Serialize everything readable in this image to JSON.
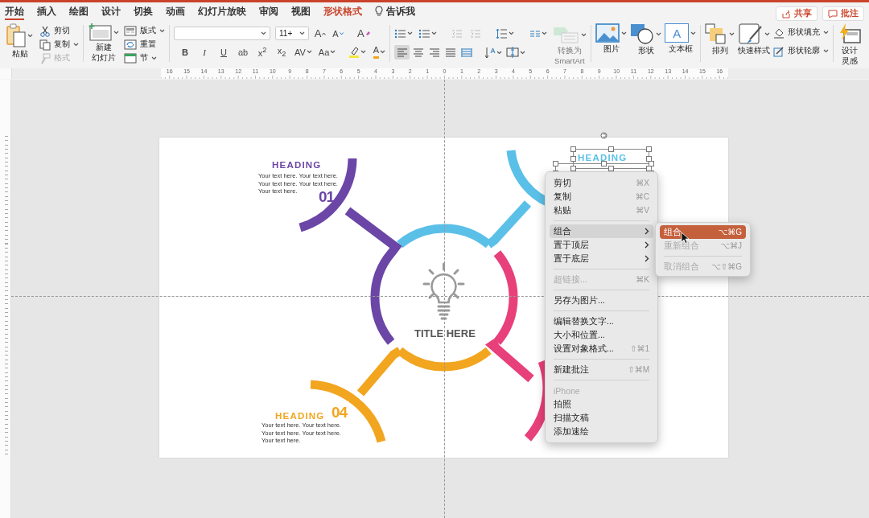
{
  "ribbon_tabs": [
    {
      "label": "开始",
      "selected": true,
      "contextual": false
    },
    {
      "label": "插入",
      "selected": false,
      "contextual": false
    },
    {
      "label": "绘图",
      "selected": false,
      "contextual": false
    },
    {
      "label": "设计",
      "selected": false,
      "contextual": false
    },
    {
      "label": "切换",
      "selected": false,
      "contextual": false
    },
    {
      "label": "动画",
      "selected": false,
      "contextual": false
    },
    {
      "label": "幻灯片放映",
      "selected": false,
      "contextual": false
    },
    {
      "label": "审阅",
      "selected": false,
      "contextual": false
    },
    {
      "label": "视图",
      "selected": false,
      "contextual": false
    },
    {
      "label": "形状格式",
      "selected": false,
      "contextual": true
    }
  ],
  "tell_me": {
    "label": "告诉我"
  },
  "header_buttons": [
    {
      "label": "共享",
      "kind": "share"
    },
    {
      "label": "批注",
      "kind": "comment"
    }
  ],
  "ribbon": {
    "clipboard": {
      "paste": "粘贴",
      "items": [
        {
          "label": "剪切",
          "kind": "cut",
          "disabled": false
        },
        {
          "label": "复制",
          "kind": "copy",
          "disabled": false
        },
        {
          "label": "格式",
          "kind": "format-painter",
          "disabled": true
        }
      ]
    },
    "slides": {
      "new_slide": [
        "新建",
        "幻灯片"
      ],
      "items": [
        {
          "label": "版式",
          "kind": "layout"
        },
        {
          "label": "重置",
          "kind": "reset"
        },
        {
          "label": "节",
          "kind": "section"
        }
      ]
    },
    "font": {
      "size": "11+",
      "grow": "A",
      "shrink": "A",
      "clear": "A",
      "font_color": "A",
      "format_buttons": [
        {
          "label": "B",
          "kind": "bold"
        },
        {
          "label": "I",
          "kind": "italic"
        },
        {
          "label": "U",
          "kind": "underline"
        },
        {
          "label": "ab",
          "kind": "strike"
        },
        {
          "label": "x$^{2}$",
          "kind": "superscript"
        },
        {
          "label": "x$_{2}$",
          "kind": "subscript"
        },
        {
          "label": "AV",
          "kind": "spacing"
        },
        {
          "label": "Aa",
          "kind": "case"
        }
      ]
    },
    "paragraph": {
      "alignment": [
        {
          "kind": "left",
          "selected": true
        },
        {
          "kind": "center",
          "selected": false
        },
        {
          "kind": "right",
          "selected": false
        },
        {
          "kind": "justify",
          "selected": false
        },
        {
          "kind": "distributed",
          "selected": false
        }
      ],
      "smartart": {
        "label": [
          "转换为",
          "SmartArt"
        ],
        "disabled": true
      }
    },
    "insert": [
      {
        "label": "图片",
        "kind": "picture"
      },
      {
        "label": "形状",
        "kind": "shapes"
      },
      {
        "label": "文本框",
        "kind": "textbox",
        "glyph": "A"
      }
    ],
    "arrange": {
      "arrange": "排列",
      "quick_styles": "快速样式",
      "fill": "形状填充",
      "outline": "形状轮廓"
    },
    "designer": [
      "设计",
      "灵感"
    ]
  },
  "ruler": {
    "labels": [
      "16",
      "15",
      "14",
      "13",
      "12",
      "11",
      "10",
      "9",
      "8",
      "7",
      "6",
      "5",
      "4",
      "3",
      "2",
      "1",
      "0",
      "1",
      "2",
      "3",
      "4",
      "5",
      "6",
      "7",
      "8",
      "9",
      "10",
      "11",
      "12",
      "13",
      "14",
      "15",
      "16"
    ]
  },
  "slide": {
    "title": "TITLE HERE",
    "sections": [
      {
        "kind": "top-left",
        "heading": "HEADING",
        "number": "01",
        "body": "Your text here. Your text here.\nYour text here. Your text here.\nYour text here.",
        "color": "#6b46a6"
      },
      {
        "kind": "top-right",
        "heading": "HEADING",
        "color": "#5bc0e8",
        "selected": true
      },
      {
        "kind": "bottom-left",
        "heading": "HEADING",
        "number": "04",
        "body": "Your text here. Your text here.\nYour text here. Your text here.\nYour text here.",
        "color": "#f2a51f"
      }
    ]
  },
  "context_menu": {
    "items": [
      {
        "kind": "command",
        "label": "剪切",
        "shortcut": "⌘X",
        "submenu": false,
        "disabled": false,
        "selected": false
      },
      {
        "kind": "command",
        "label": "复制",
        "shortcut": "⌘C",
        "submenu": false,
        "disabled": false,
        "selected": false
      },
      {
        "kind": "command",
        "label": "粘贴",
        "shortcut": "⌘V",
        "submenu": false,
        "disabled": false,
        "selected": false
      },
      {
        "kind": "separator"
      },
      {
        "kind": "command",
        "label": "组合",
        "submenu": true,
        "disabled": false,
        "selected": true
      },
      {
        "kind": "command",
        "label": "置于顶层",
        "submenu": true,
        "disabled": false,
        "selected": false
      },
      {
        "kind": "command",
        "label": "置于底层",
        "submenu": true,
        "disabled": false,
        "selected": false
      },
      {
        "kind": "separator"
      },
      {
        "kind": "command",
        "label": "超链接...",
        "shortcut": "⌘K",
        "submenu": false,
        "disabled": true,
        "selected": false
      },
      {
        "kind": "separator"
      },
      {
        "kind": "command",
        "label": "另存为图片...",
        "submenu": false,
        "disabled": false,
        "selected": false
      },
      {
        "kind": "separator"
      },
      {
        "kind": "command",
        "label": "编辑替换文字...",
        "submenu": false,
        "disabled": false,
        "selected": false
      },
      {
        "kind": "command",
        "label": "大小和位置...",
        "submenu": false,
        "disabled": false,
        "selected": false
      },
      {
        "kind": "command",
        "label": "设置对象格式...",
        "shortcut": "⇧⌘1",
        "submenu": false,
        "disabled": false,
        "selected": false
      },
      {
        "kind": "separator"
      },
      {
        "kind": "command",
        "label": "新建批注",
        "shortcut": "⇧⌘M",
        "submenu": false,
        "disabled": false,
        "selected": false
      },
      {
        "kind": "separator"
      },
      {
        "kind": "command",
        "label": "iPhone",
        "submenu": false,
        "disabled": true,
        "selected": false
      },
      {
        "kind": "command",
        "label": "拍照",
        "submenu": false,
        "disabled": false,
        "selected": false
      },
      {
        "kind": "command",
        "label": "扫描文稿",
        "submenu": false,
        "disabled": false,
        "selected": false
      },
      {
        "kind": "command",
        "label": "添加速绘",
        "submenu": false,
        "disabled": false,
        "selected": false
      }
    ]
  },
  "submenu": {
    "items": [
      {
        "kind": "command",
        "label": "组合",
        "shortcut": "⌥⌘G",
        "submenu": false,
        "disabled": false,
        "selected": true
      },
      {
        "kind": "command",
        "label": "重新组合",
        "shortcut": "⌥⌘J",
        "submenu": false,
        "disabled": true,
        "selected": false
      },
      {
        "kind": "separator"
      },
      {
        "kind": "command",
        "label": "取消组合",
        "shortcut": "⌥⇧⌘G",
        "submenu": false,
        "disabled": true,
        "selected": false
      }
    ]
  }
}
